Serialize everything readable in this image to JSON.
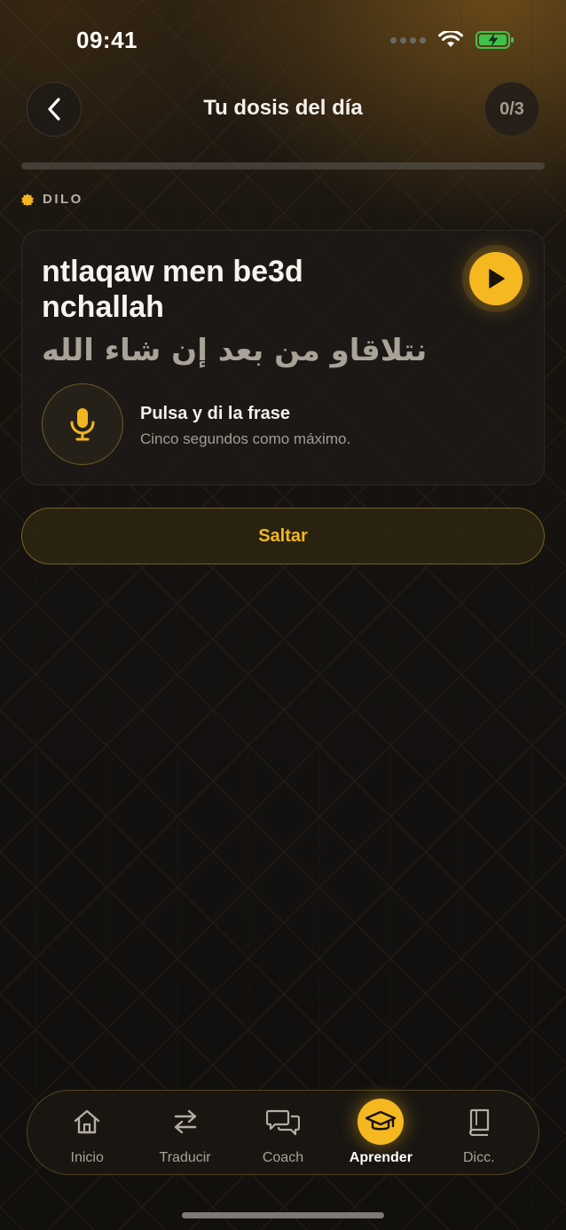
{
  "status_bar": {
    "time": "09:41"
  },
  "header": {
    "title": "Tu dosis del día",
    "progress_label": "0/3",
    "progress_value": 0
  },
  "section": {
    "label": "DILO"
  },
  "card": {
    "phrase_latin": "ntlaqaw men be3d nchallah",
    "phrase_arabic": "نتلاقاو من بعد إن شاء الله",
    "mic_title": "Pulsa y di la frase",
    "mic_subtitle": "Cinco segundos como máximo."
  },
  "skip_label": "Saltar",
  "tabbar": {
    "items": [
      {
        "label": "Inicio",
        "icon": "home-icon"
      },
      {
        "label": "Traducir",
        "icon": "swap-arrows-icon"
      },
      {
        "label": "Coach",
        "icon": "chat-bubbles-icon"
      },
      {
        "label": "Aprender",
        "icon": "graduation-cap-icon"
      },
      {
        "label": "Dicc.",
        "icon": "book-icon"
      }
    ],
    "active_index": 3
  },
  "colors": {
    "accent": "#f6b820",
    "background": "#141210",
    "card": "#1c1916"
  }
}
